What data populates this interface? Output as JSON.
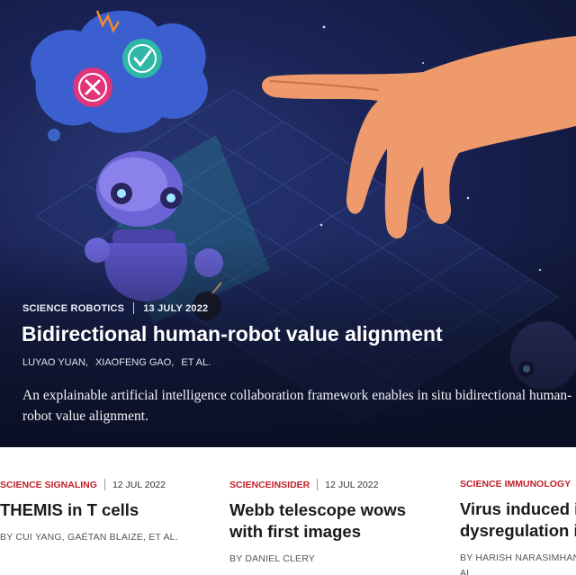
{
  "hero": {
    "journal": "SCIENCE ROBOTICS",
    "date": "13 JULY 2022",
    "title": "Bidirectional human-robot value alignment",
    "authors": [
      "LUYAO YUAN,",
      "XIAOFENG GAO,",
      "ET AL."
    ],
    "summary_line1": "An explainable artificial intelligence collaboration framework enables in situ bidirectional human-",
    "summary_line2": "robot value alignment."
  },
  "cards": [
    {
      "journal": "SCIENCE SIGNALING",
      "date": "12 JUL 2022",
      "title_line1": "THEMIS in T cells",
      "title_line2": "",
      "authors_line1": "BY CUI YANG,  GAËTAN BLAIZE,  ET AL.",
      "authors_line2": ""
    },
    {
      "journal": "SCIENCEINSIDER",
      "date": "12 JUL 2022",
      "title_line1": "Webb telescope wows",
      "title_line2": "with first images",
      "authors_line1": "BY DANIEL CLERY",
      "authors_line2": ""
    },
    {
      "journal": "SCIENCE IMMUNOLOGY",
      "date": "",
      "title_line1": "Virus induced i",
      "title_line2": "dysregulation i",
      "authors_line1": "BY HARISH NARASIMHAN",
      "authors_line2": "AL."
    }
  ],
  "colors": {
    "journal_red": "#c0202a",
    "hero_bg": "#1a2356",
    "thought_pink": "#e0357a",
    "thought_teal": "#2fb8a8"
  },
  "icons": [
    "close-icon",
    "check-icon"
  ]
}
